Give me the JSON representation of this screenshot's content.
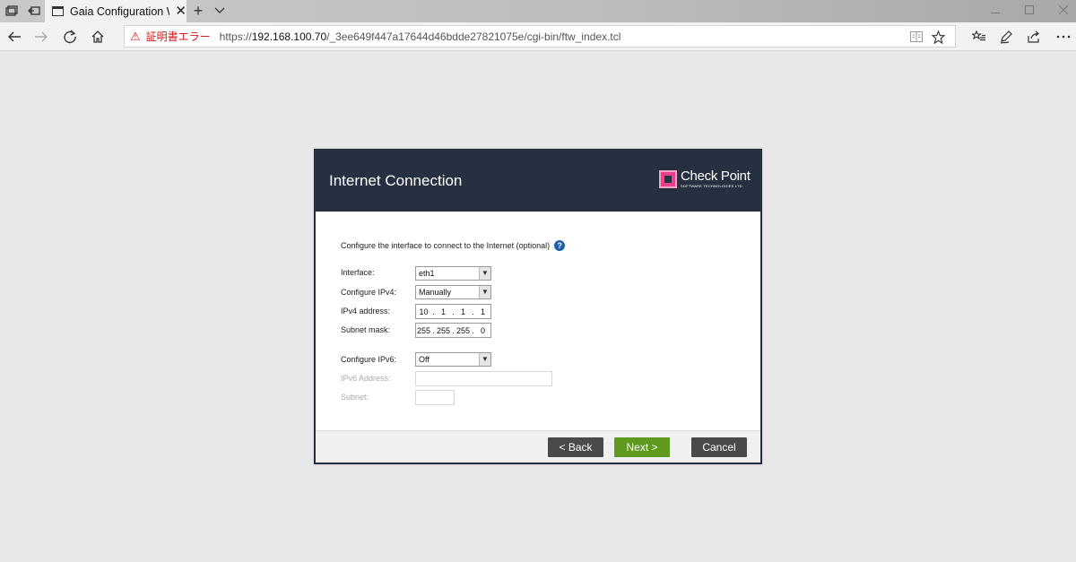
{
  "browser": {
    "tab_title": "Gaia Configuration Wiz",
    "tab_close_glyph": "✕",
    "new_tab_glyph": "+",
    "tab_list_glyph": "⌄",
    "cert_error": "証明書エラー",
    "url_prefix": "https://",
    "url_host": "192.168.100.70",
    "url_path": "/_3ee649f447a17644d46bdde27821075e/cgi-bin/ftw_index.tcl",
    "icons": [
      "tab-set-aside-icon",
      "tab-restore-icon",
      "back-icon",
      "forward-icon",
      "refresh-icon",
      "home-icon",
      "reading-view-icon",
      "favorite-star-icon",
      "favorites-hub-icon",
      "pen-icon",
      "share-icon",
      "more-icon"
    ]
  },
  "dialog": {
    "title": "Internet Connection",
    "logo_name": "Check Point",
    "logo_sub": "SOFTWARE TECHNOLOGIES LTD.",
    "intro": "Configure the interface to connect to the Internet (optional)",
    "help_glyph": "?",
    "fields": {
      "interface_label": "Interface:",
      "interface_value": "eth1",
      "ipv4_label": "Configure IPv4:",
      "ipv4_value": "Manually",
      "ipv4_address_label": "IPv4 address:",
      "ipv4_address": [
        "10",
        "1",
        "1",
        "1"
      ],
      "subnet_mask_label": "Subnet mask:",
      "subnet_mask": [
        "255",
        "255",
        "255",
        "0"
      ],
      "ipv6_label": "Configure IPv6:",
      "ipv6_value": "Off",
      "ipv6_address_label": "IPv6 Address:",
      "ipv6_subnet_label": "Subnet:"
    },
    "buttons": {
      "back": "< Back",
      "next": "Next >",
      "cancel": "Cancel"
    }
  },
  "colors": {
    "header": "#263041",
    "next_button": "#5f9a1e",
    "dark_button": "#4a4a4a",
    "cert_error": "#d01c1c",
    "logo_accent": "#e9418b"
  }
}
